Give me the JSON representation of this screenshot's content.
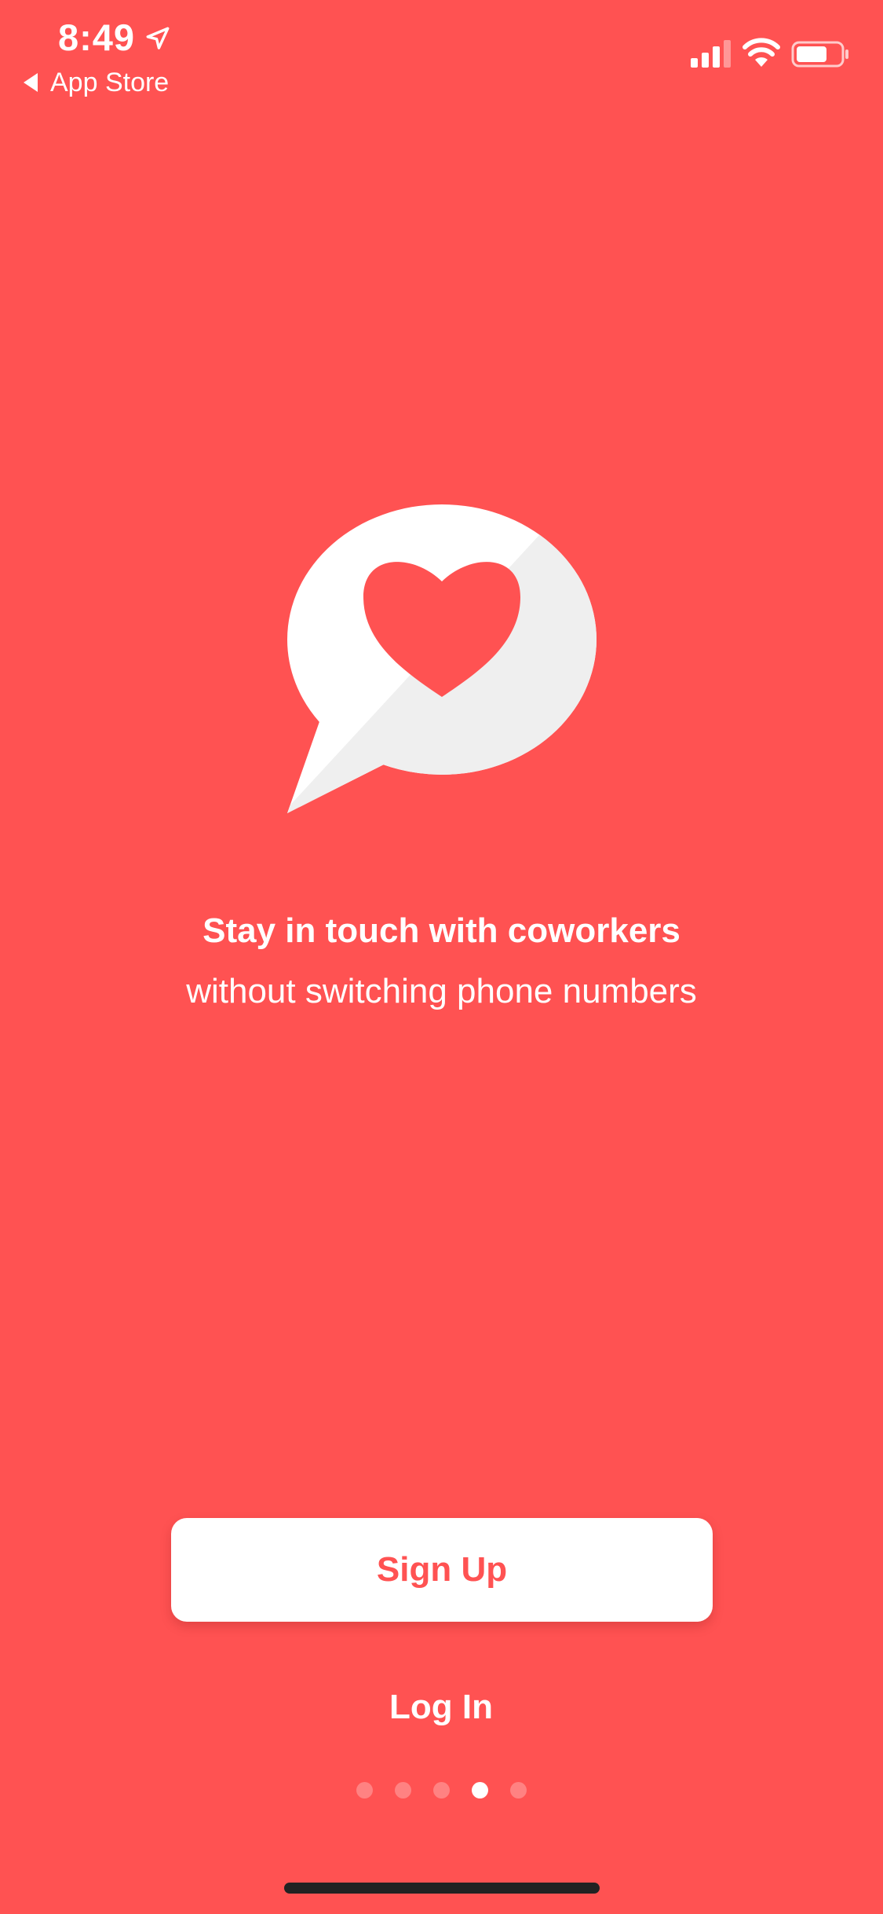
{
  "colors": {
    "background": "#ff5252",
    "primary_text": "#ffffff",
    "button_background": "#ffffff",
    "button_text": "#ff5252",
    "bubble": "#ffffff",
    "bubble_shade": "#efefef",
    "heart": "#ff5252",
    "home_indicator": "#222222"
  },
  "status_bar": {
    "time": "8:49",
    "back_label": "App Store",
    "icons": [
      "location-arrow-icon",
      "back-triangle-icon",
      "cellular-signal-icon",
      "wifi-icon",
      "battery-icon"
    ]
  },
  "illustration": {
    "icon": "speech-bubble-heart-icon"
  },
  "onboarding": {
    "headline": "Stay in touch with coworkers",
    "subhead": "without switching phone numbers"
  },
  "actions": {
    "signup_label": "Sign Up",
    "login_label": "Log In"
  },
  "pager": {
    "total_pages": 5,
    "current_page": 4
  }
}
